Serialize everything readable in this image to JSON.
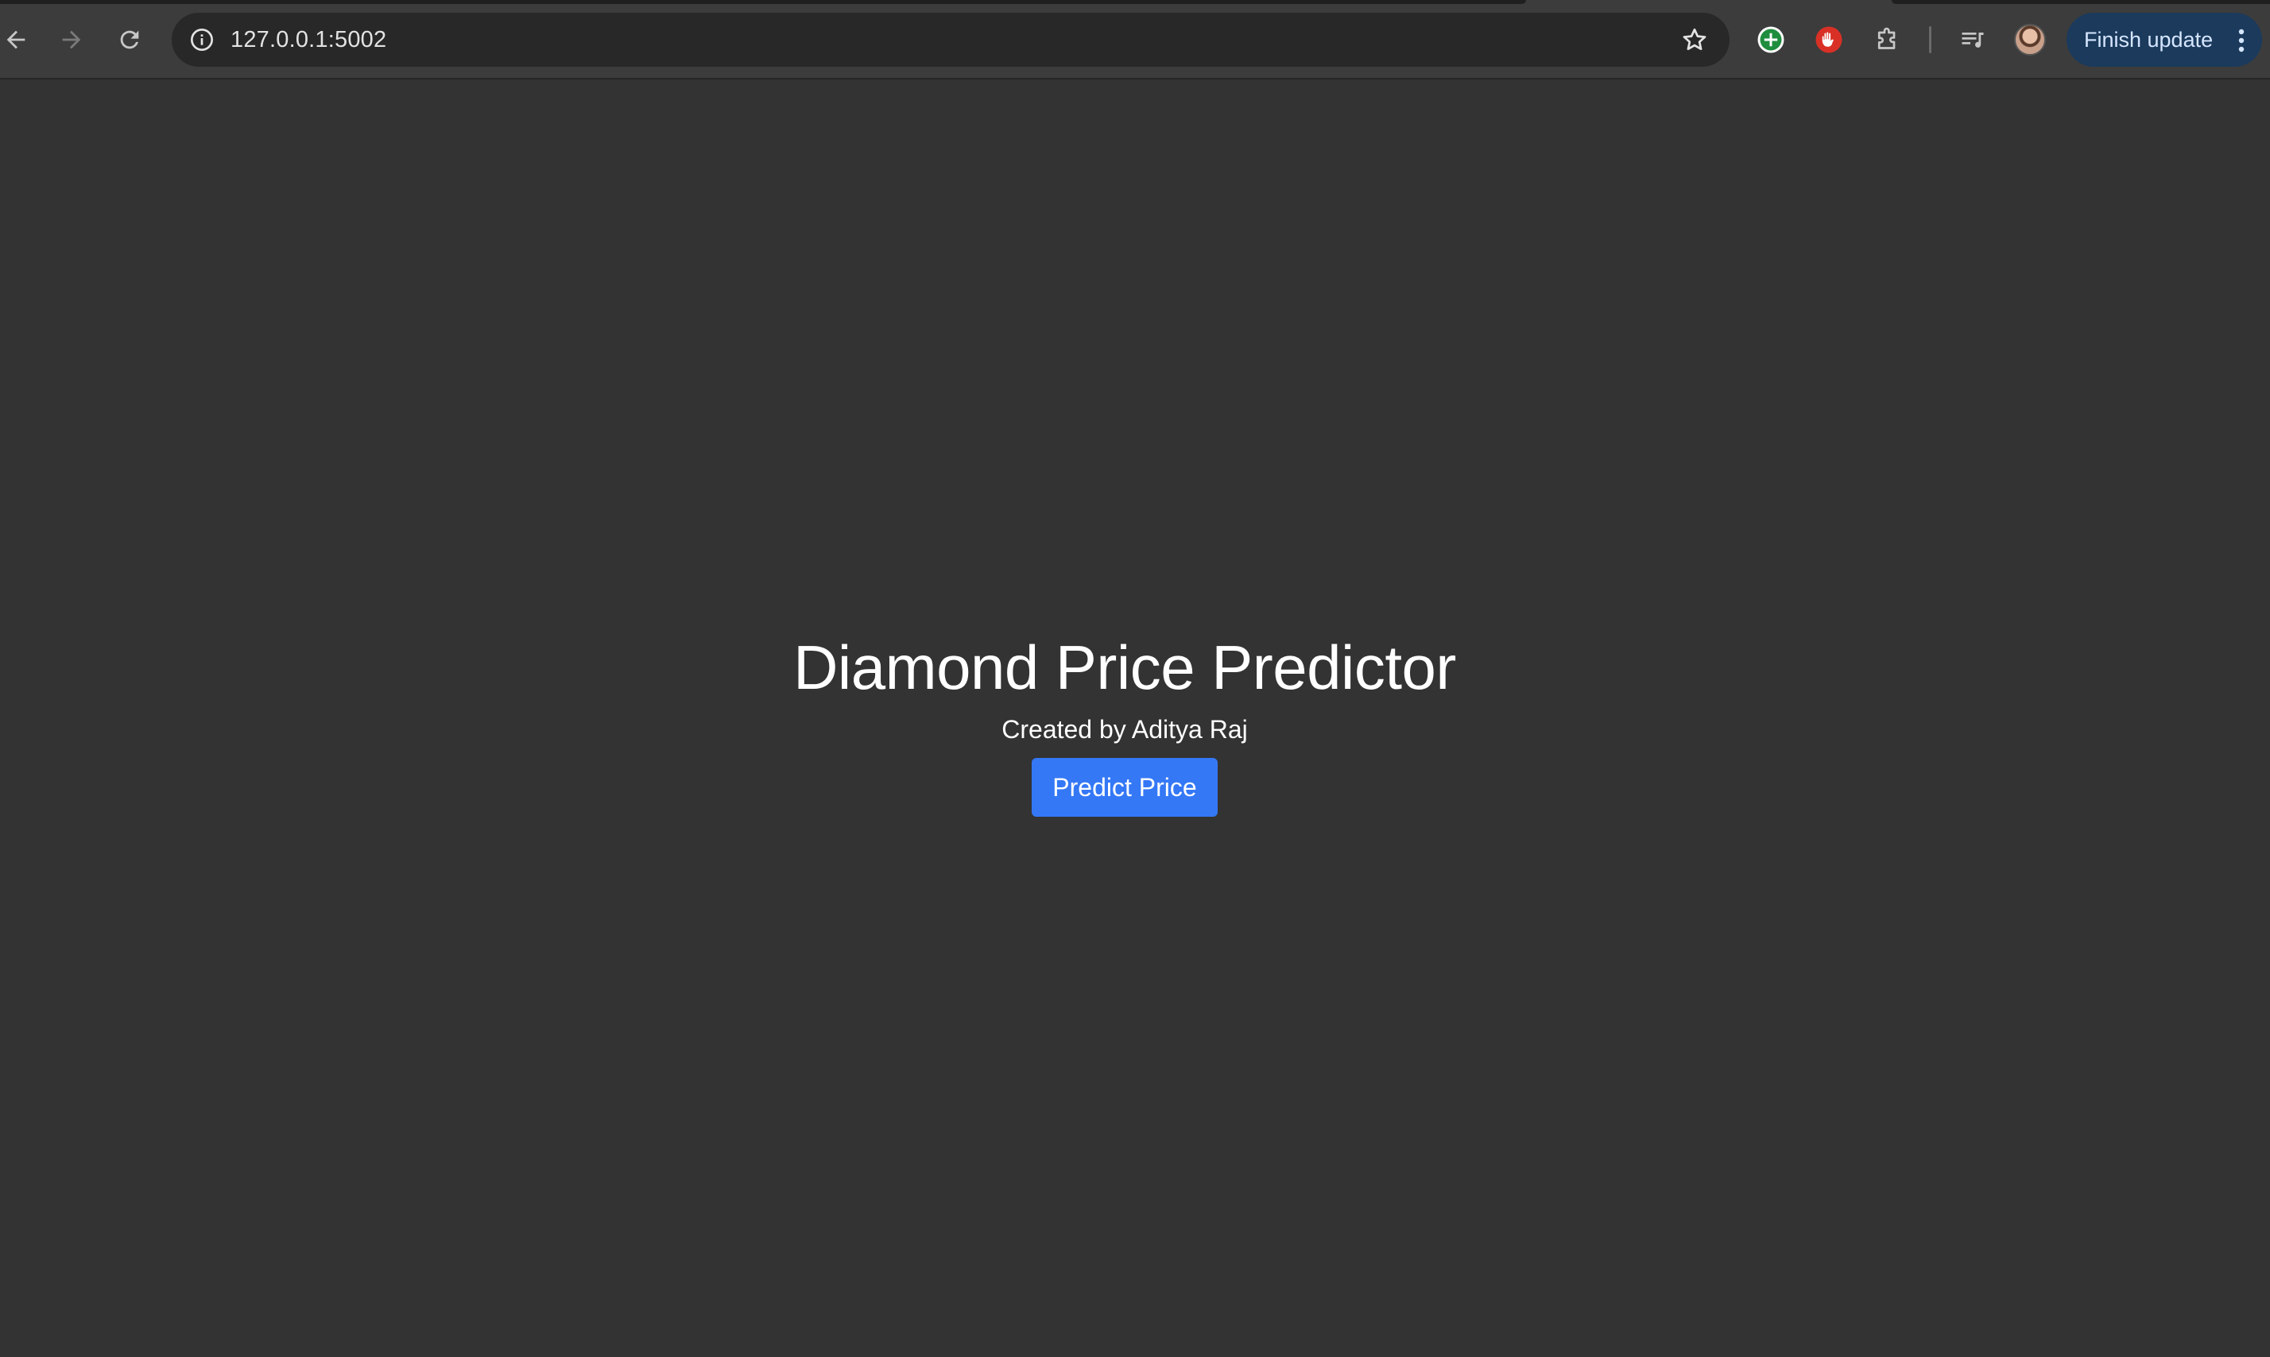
{
  "browser": {
    "url": "127.0.0.1:5002",
    "finish_update_label": "Finish update",
    "accent_color": "#1b3a5c"
  },
  "icons": {
    "back": "arrow-left-icon",
    "forward": "arrow-right-icon",
    "reload": "reload-icon",
    "site_info": "info-icon",
    "bookmark": "star-icon",
    "extension_1": "green-plus-icon",
    "extension_2": "red-hand-icon",
    "extensions": "puzzle-icon",
    "media": "media-queue-icon",
    "menu": "more-vert-icon"
  },
  "page": {
    "title": "Diamond Price Predictor",
    "subtitle": "Created by Aditya Raj",
    "predict_button_label": "Predict Price",
    "background_color": "#333333",
    "button_color": "#3478f6"
  }
}
